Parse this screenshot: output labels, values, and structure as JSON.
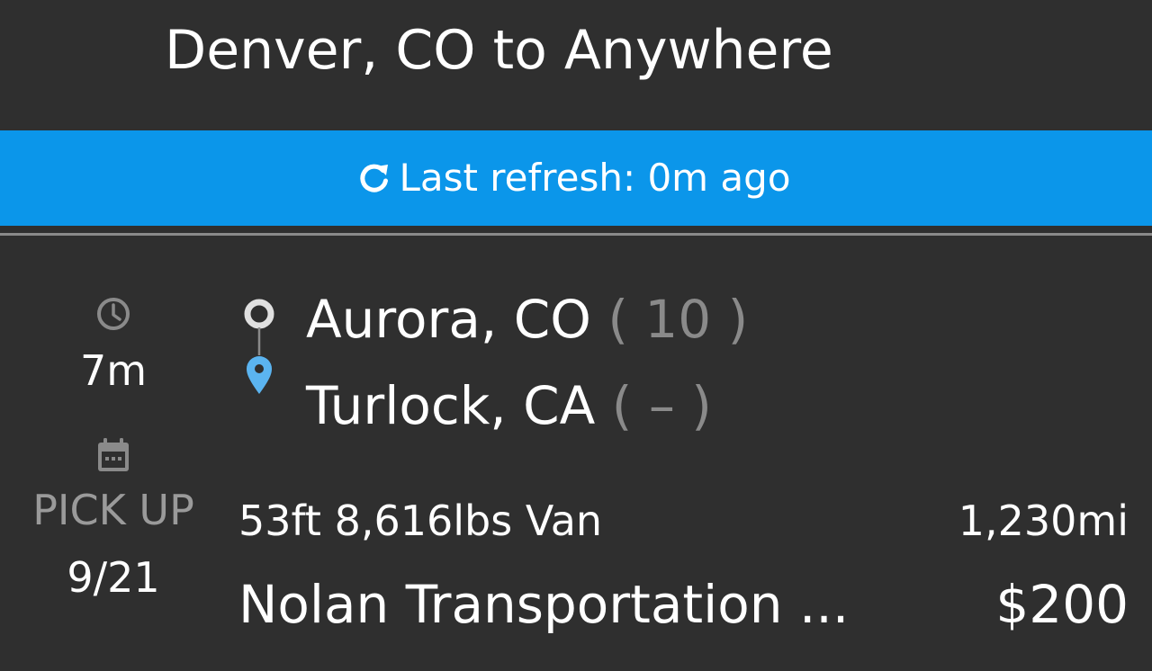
{
  "header": {
    "title": "Denver, CO to Anywhere"
  },
  "refresh_bar": {
    "icon": "refresh-icon",
    "text": "Last refresh: 0m ago",
    "background_color": "#0b96ea"
  },
  "load": {
    "age_icon": "clock-icon",
    "age": "7m",
    "pickup_icon": "calendar-icon",
    "pickup_label": "PICK UP",
    "pickup_date": "9/21",
    "origin": {
      "icon": "origin-circle-icon",
      "city": "Aurora, CO",
      "deadhead": "( 10 )"
    },
    "destination": {
      "icon": "map-pin-icon",
      "icon_color": "#5bb4f0",
      "city": "Turlock, CA",
      "deadhead": "( – )"
    },
    "equipment": "53ft 8,616lbs Van",
    "distance": "1,230mi",
    "company": "Nolan Transportation ...",
    "rate": "$200"
  }
}
